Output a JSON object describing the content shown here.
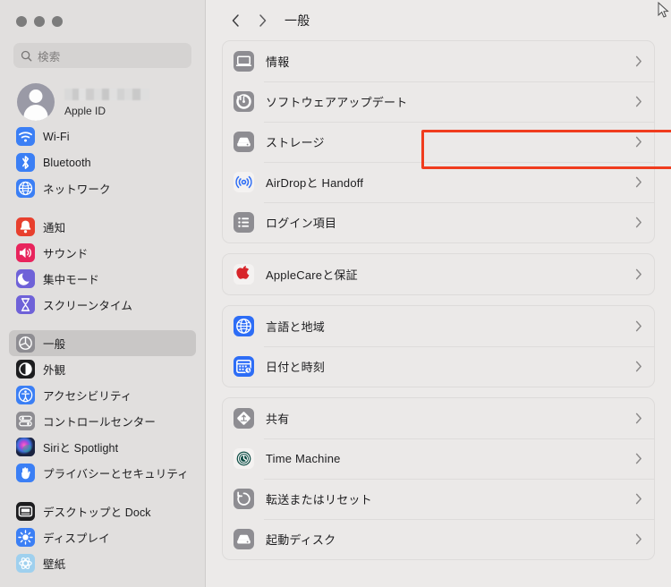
{
  "window": {
    "traffic_lights": [
      "close",
      "minimize",
      "zoom"
    ]
  },
  "sidebar": {
    "search": {
      "placeholder": "検索",
      "value": "",
      "icon": "search-icon"
    },
    "account": {
      "name_redacted": true,
      "subtitle": "Apple ID",
      "avatar_icon": "person-avatar-icon"
    },
    "groups": [
      {
        "items": [
          {
            "label": "Wi-Fi",
            "icon": "wifi-icon",
            "color": "#3b7ff5",
            "selected": false
          },
          {
            "label": "Bluetooth",
            "icon": "bluetooth-icon",
            "color": "#3b7ff5",
            "selected": false
          },
          {
            "label": "ネットワーク",
            "icon": "network-globe-icon",
            "color": "#3b7ff5",
            "selected": false
          }
        ]
      },
      {
        "items": [
          {
            "label": "通知",
            "icon": "notifications-bell-icon",
            "color": "#e8402e",
            "selected": false
          },
          {
            "label": "サウンド",
            "icon": "sound-speaker-icon",
            "color": "#e8245c",
            "selected": false
          },
          {
            "label": "集中モード",
            "icon": "focus-moon-icon",
            "color": "#6f62d8",
            "selected": false
          },
          {
            "label": "スクリーンタイム",
            "icon": "screen-time-hourglass-icon",
            "color": "#6f62d8",
            "selected": false
          }
        ]
      },
      {
        "items": [
          {
            "label": "一般",
            "icon": "general-gear-icon",
            "color": "#8e8d92",
            "selected": true
          },
          {
            "label": "外観",
            "icon": "appearance-icon",
            "color": "#1d1d1f",
            "selected": false
          },
          {
            "label": "アクセシビリティ",
            "icon": "accessibility-icon",
            "color": "#3b7ff5",
            "selected": false
          },
          {
            "label": "コントロールセンター",
            "icon": "control-center-icon",
            "color": "#8e8d92",
            "selected": false
          },
          {
            "label": "Siriと Spotlight",
            "icon": "siri-spotlight-icon",
            "color": "#3a2b4f",
            "selected": false
          },
          {
            "label": "プライバシーとセキュリティ",
            "icon": "privacy-hand-icon",
            "color": "#3b7ff5",
            "selected": false
          }
        ]
      },
      {
        "items": [
          {
            "label": "デスクトップと Dock",
            "icon": "desktop-dock-icon",
            "color": "#1d1d1f",
            "selected": false
          },
          {
            "label": "ディスプレイ",
            "icon": "display-brightness-icon",
            "color": "#3b7ff5",
            "selected": false
          },
          {
            "label": "壁紙",
            "icon": "wallpaper-icon",
            "color": "#9fd0ee",
            "selected": false
          }
        ]
      }
    ]
  },
  "main": {
    "nav": {
      "back_icon": "chevron-left-icon",
      "forward_icon": "chevron-right-icon",
      "title": "一般"
    },
    "cards": [
      {
        "rows": [
          {
            "label": "情報",
            "icon": "about-laptop-icon",
            "color": "#8e8d92",
            "highlighted": false
          },
          {
            "label": "ソフトウェアアップデート",
            "icon": "software-update-icon",
            "color": "#8e8d92",
            "highlighted": false
          },
          {
            "label": "ストレージ",
            "icon": "storage-disk-icon",
            "color": "#8e8d92",
            "highlighted": true
          },
          {
            "label": "AirDropと Handoff",
            "icon": "airdrop-icon",
            "color": "#3b7ff5",
            "highlighted": false
          },
          {
            "label": "ログイン項目",
            "icon": "login-items-list-icon",
            "color": "#8e8d92",
            "highlighted": false
          }
        ]
      },
      {
        "rows": [
          {
            "label": "AppleCareと保証",
            "icon": "applecare-apple-icon",
            "color": "#e8402e",
            "highlighted": false
          }
        ]
      },
      {
        "rows": [
          {
            "label": "言語と地域",
            "icon": "language-region-globe-icon",
            "color": "#2d6df6",
            "highlighted": false
          },
          {
            "label": "日付と時刻",
            "icon": "date-time-icon",
            "color": "#2d6df6",
            "highlighted": false
          }
        ]
      },
      {
        "rows": [
          {
            "label": "共有",
            "icon": "sharing-icon",
            "color": "#8e8d92",
            "highlighted": false
          },
          {
            "label": "Time Machine",
            "icon": "time-machine-icon",
            "color": "#1f5c52",
            "highlighted": false
          },
          {
            "label": "転送またはリセット",
            "icon": "transfer-reset-icon",
            "color": "#8e8d92",
            "highlighted": false
          },
          {
            "label": "起動ディスク",
            "icon": "startup-disk-icon",
            "color": "#8e8d92",
            "highlighted": false
          }
        ]
      }
    ],
    "annotation": {
      "type": "highlight-rectangle",
      "target_label": "ストレージ",
      "color": "#f03c1e"
    }
  }
}
